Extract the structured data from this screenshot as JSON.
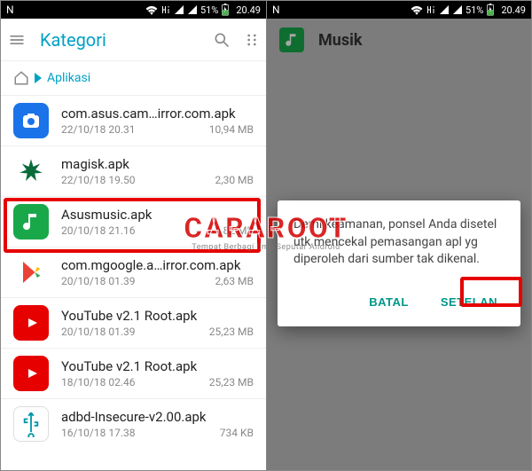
{
  "status": {
    "time": "20.49",
    "battery": "51%"
  },
  "left": {
    "title": "Kategori",
    "breadcrumb_label": "Aplikasi",
    "items": [
      {
        "name": "com.asus.cam…irror.com.apk",
        "date": "22/10/18 20.31",
        "size": "10,94 MB",
        "icon": "cam"
      },
      {
        "name": "magisk.apk",
        "date": "22/10/18 19.50",
        "size": "2,30 MB",
        "icon": "magisk"
      },
      {
        "name": "Asusmusic.apk",
        "date": "20/10/18 21.16",
        "size": "6,82 MB",
        "icon": "music",
        "highlight": true
      },
      {
        "name": "com.mgoogle.a…irror.com.apk",
        "date": "20/10/18 01.39",
        "size": "2,63 MB",
        "icon": "play"
      },
      {
        "name": "YouTube v2.1 Root.apk",
        "date": "20/10/18 01.39",
        "size": "25,23 MB",
        "icon": "yt"
      },
      {
        "name": "YouTube v2.1 Root.apk",
        "date": "18/10/18 02.46",
        "size": "25,23 MB",
        "icon": "yt"
      },
      {
        "name": "adbd-Insecure-v2.00.apk",
        "date": "16/10/18 17.38",
        "size": "734 KB",
        "icon": "usb"
      }
    ]
  },
  "right": {
    "title": "Musik",
    "dialog": {
      "message": "Demi keamanan, ponsel Anda disetel utk mencekal pemasangan apl yg diperoleh dari sumber tak dikenal.",
      "cancel": "BATAL",
      "settings": "SETELAN"
    }
  },
  "watermark": {
    "main": "CARAROOT",
    "sub": "Tempat Berbagi Ilmu Seputar Android"
  }
}
